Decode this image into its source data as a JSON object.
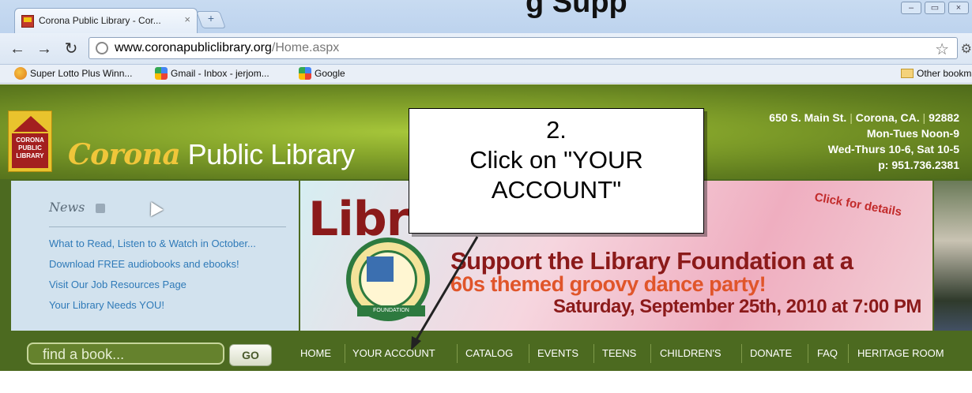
{
  "browser": {
    "tab_title": "Corona Public Library - Cor...",
    "tab_close": "×",
    "new_tab": "+",
    "overlay_heading": "g  Supp",
    "url_domain": "www.coronapubliclibrary.org",
    "url_path": "/Home.aspx",
    "bookmarks": [
      {
        "label": "Super Lotto Plus Winn...",
        "icon": "lotto-icon"
      },
      {
        "label": "Gmail - Inbox - jerjom...",
        "icon": "google-icon"
      },
      {
        "label": "Google",
        "icon": "google-icon"
      }
    ],
    "other_bookmarks": "Other bookmar"
  },
  "site": {
    "logo_lines": [
      "CORONA",
      "PUBLIC",
      "LIBRARY"
    ],
    "name_brand": "Corona",
    "name_rest": " Public Library",
    "address": {
      "street": "650 S. Main St.",
      "city": "Corona, CA.",
      "zip": "92882",
      "hours1": "Mon-Tues Noon-9",
      "hours2": "Wed-Thurs 10-6, Sat 10-5",
      "phone": "p: 951.736.2381"
    },
    "news": {
      "title": "News",
      "items": [
        "What to Read, Listen to & Watch in October...",
        "Download FREE audiobooks and ebooks!",
        "Visit Our Job Resources Page",
        "Your Library Needs YOU!"
      ]
    },
    "banner": {
      "word": "Libr",
      "seal_ribbon": "FOUNDATION",
      "line1": "Support the Library Foundation at a",
      "line2": "60s themed groovy dance party!",
      "line3": "Saturday, September 25th, 2010 at 7:00 PM",
      "click_details": "Click for details"
    },
    "search": {
      "placeholder": "find a book...",
      "go": "GO"
    },
    "nav": [
      "HOME",
      "YOUR ACCOUNT",
      "CATALOG",
      "EVENTS",
      "TEENS",
      "CHILDREN'S",
      "DONATE",
      "FAQ",
      "HERITAGE ROOM"
    ]
  },
  "callout": {
    "step": "2.",
    "line1": "Click on \"YOUR",
    "line2": "ACCOUNT\""
  }
}
